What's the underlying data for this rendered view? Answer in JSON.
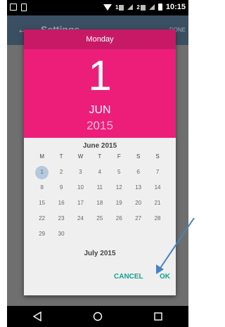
{
  "status_bar": {
    "sim1": "1",
    "sim2": "2",
    "time": "10:15"
  },
  "app_bar": {
    "back_icon": "arrow-left-icon",
    "title": "Settings",
    "action": "DONE"
  },
  "dialog": {
    "day_name": "Monday",
    "day": "1",
    "month": "JUN",
    "year": "2015",
    "calendar": {
      "current_month": "June 2015",
      "next_month": "July 2015",
      "weekdays": [
        "M",
        "T",
        "W",
        "T",
        "F",
        "S",
        "S"
      ],
      "weeks": [
        [
          "1",
          "2",
          "3",
          "4",
          "5",
          "6",
          "7"
        ],
        [
          "8",
          "9",
          "10",
          "11",
          "12",
          "13",
          "14"
        ],
        [
          "15",
          "16",
          "17",
          "18",
          "19",
          "20",
          "21"
        ],
        [
          "22",
          "23",
          "24",
          "25",
          "26",
          "27",
          "28"
        ],
        [
          "29",
          "30",
          "",
          "",
          "",
          "",
          ""
        ]
      ],
      "selected_day": "1"
    },
    "cancel_label": "CANCEL",
    "ok_label": "OK"
  },
  "colors": {
    "header_pink": "#ec1e7a",
    "dayname_bar": "#c81966",
    "accent_teal": "#1a9f8e",
    "selected_circle": "#b6c8dc",
    "annotation_arrow": "#4a82c0"
  },
  "nav_bar": {
    "icons": [
      "back-icon",
      "home-icon",
      "recents-icon"
    ]
  }
}
